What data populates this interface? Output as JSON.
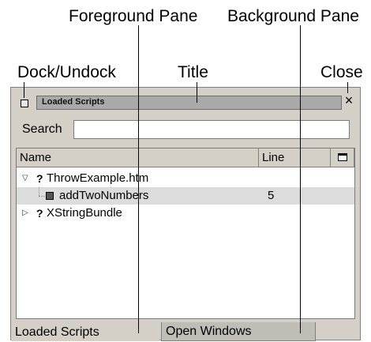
{
  "callouts": {
    "foreground_pane": "Foreground Pane",
    "background_pane": "Background Pane",
    "dock_undock": "Dock/Undock",
    "title": "Title",
    "close": "Close"
  },
  "panel": {
    "title": "Loaded Scripts",
    "search": {
      "label": "Search",
      "value": "",
      "placeholder": ""
    },
    "tree": {
      "columns": [
        "Name",
        "Line"
      ],
      "column_picker_icon": "column-picker-icon",
      "rows": [
        {
          "twisty": "▽",
          "status": "?",
          "label": "ThrowExample.htm",
          "line": "",
          "expanded": true
        },
        {
          "twisty": "",
          "status": "",
          "label": "addTwoNumbers",
          "line": "5",
          "icon": "function-icon",
          "selected": true
        },
        {
          "twisty": "▷",
          "status": "?",
          "label": "XStringBundle",
          "line": "",
          "expanded": false
        }
      ]
    },
    "tabs": [
      {
        "label": "Loaded Scripts",
        "active": true
      },
      {
        "label": "Open Windows",
        "active": false
      }
    ],
    "close_glyph": "×"
  },
  "colors": {
    "panel_bg": "#d4d0c8",
    "title_field": "#a9a9a9",
    "selected_row": "#dcdcdc"
  }
}
